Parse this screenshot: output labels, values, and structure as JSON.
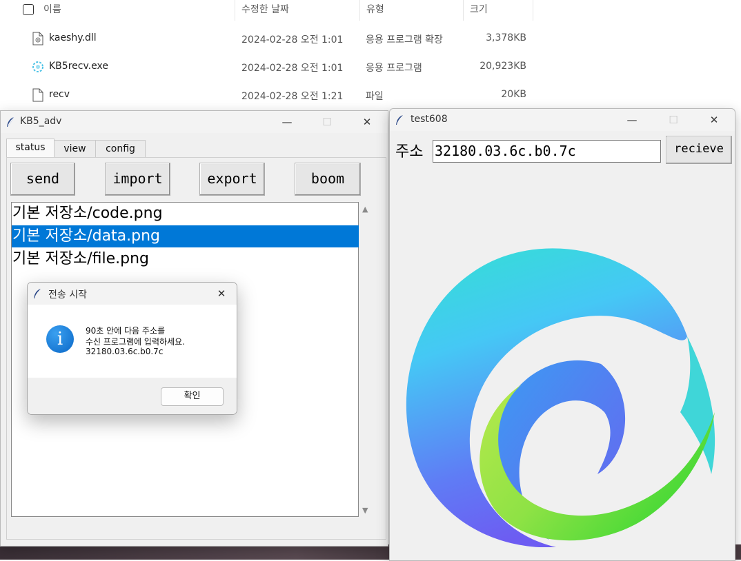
{
  "explorer": {
    "columns": {
      "name": "이름",
      "modified": "수정한 날짜",
      "type": "유형",
      "size": "크기"
    },
    "files": [
      {
        "icon": "dll-file-icon",
        "name": "kaeshy.dll",
        "modified": "2024-02-28 오전 1:01",
        "type": "응용 프로그램 확장",
        "size": "3,378KB"
      },
      {
        "icon": "exe-file-icon",
        "name": "KB5recv.exe",
        "modified": "2024-02-28 오전 1:01",
        "type": "응용 프로그램",
        "size": "20,923KB"
      },
      {
        "icon": "generic-file-icon",
        "name": "recv",
        "modified": "2024-02-28 오전 1:21",
        "type": "파일",
        "size": "20KB"
      }
    ]
  },
  "kb5_window": {
    "title": "KB5_adv",
    "tabs": [
      "status",
      "view",
      "config"
    ],
    "active_tab": "status",
    "buttons": {
      "send": "send",
      "import": "import",
      "export": "export",
      "boom": "boom"
    },
    "list_items": [
      "기본 저장소/code.png",
      "기본 저장소/data.png",
      "기본 저장소/file.png"
    ],
    "selected_item": "기본 저장소/data.png"
  },
  "dialog": {
    "title": "전송 시작",
    "message_lines": [
      "90초 안에 다음 주소를",
      "수신 프로그램에 입력하세요.",
      "32180.03.6c.b0.7c"
    ],
    "ok_label": "확인"
  },
  "test_window": {
    "title": "test608",
    "address_label": "주소",
    "address_value": "32180.03.6c.b0.7c",
    "receive_button": "recieve"
  },
  "colors": {
    "selection": "#0078d7",
    "window_bg": "#f0f0f0",
    "info_icon": "#0a67c7"
  }
}
